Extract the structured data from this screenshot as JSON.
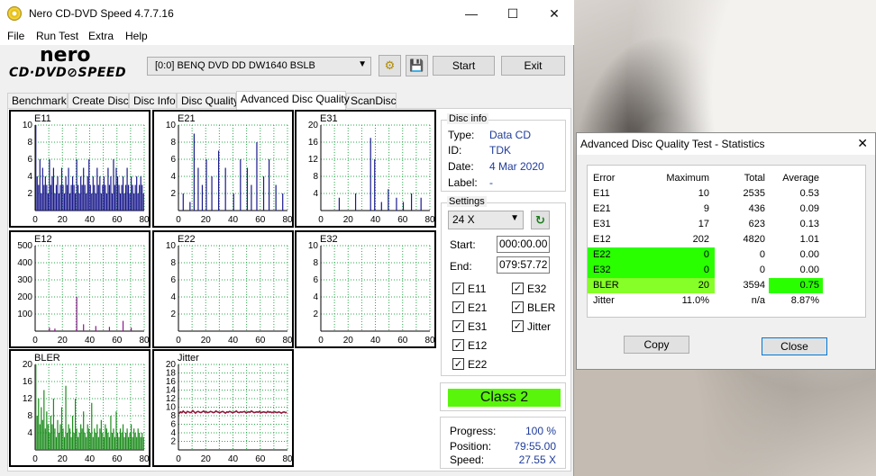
{
  "window": {
    "title": "Nero CD-DVD Speed 4.7.7.16",
    "minimize": "—",
    "maximize": "☐",
    "close": "✕"
  },
  "menu": [
    "File",
    "Run Test",
    "Extra",
    "Help"
  ],
  "logo": {
    "line1": "nero",
    "line2": "CD·DVD⊘SPEED"
  },
  "drive": {
    "selected": "[0:0]   BENQ DVD DD DW1640 BSLB"
  },
  "toolbar": {
    "start": "Start",
    "exit": "Exit"
  },
  "tabs": [
    "Benchmark",
    "Create Disc",
    "Disc Info",
    "Disc Quality",
    "Advanced Disc Quality",
    "ScanDisc"
  ],
  "active_tab": 4,
  "disc_info": {
    "legend": "Disc info",
    "type_label": "Type:",
    "type": "Data CD",
    "id_label": "ID:",
    "id": "TDK",
    "date_label": "Date:",
    "date": "4 Mar 2020",
    "label_label": "Label:",
    "label": "-"
  },
  "settings": {
    "legend": "Settings",
    "speed": "24 X",
    "start_label": "Start:",
    "start": "000:00.00",
    "end_label": "End:",
    "end": "079:57.72",
    "checks": [
      {
        "label": "E11",
        "checked": true
      },
      {
        "label": "E32",
        "checked": true
      },
      {
        "label": "E21",
        "checked": true
      },
      {
        "label": "BLER",
        "checked": true
      },
      {
        "label": "E31",
        "checked": true
      },
      {
        "label": "Jitter",
        "checked": true
      },
      {
        "label": "E12",
        "checked": true
      },
      {
        "label": "E22",
        "checked": true
      }
    ]
  },
  "class": "Class 2",
  "progress": {
    "progress_label": "Progress:",
    "progress": "100 %",
    "position_label": "Position:",
    "position": "79:55.00",
    "speed_label": "Speed:",
    "speed": "27.55 X"
  },
  "colors": {
    "e_bar": "#1a1a8c",
    "e12_bar": "#8c1a8c",
    "bler_bar": "#1c8c1c",
    "jitter": "#8c1a3c",
    "grid": "#2aa84a",
    "class_bg": "#59f50b",
    "hl_green": "#2aff00",
    "hl_lime": "#86ff28"
  },
  "chart_data": [
    {
      "type": "bar",
      "title": "E11",
      "x_ticks": [
        0,
        20,
        40,
        60,
        80
      ],
      "y_ticks": [
        2,
        4,
        6,
        8,
        10
      ],
      "ylim": [
        0,
        10
      ],
      "xlim": [
        0,
        80
      ],
      "values": [
        10,
        4,
        3,
        6,
        2,
        5,
        3,
        4,
        3,
        2,
        6,
        3,
        4,
        5,
        2,
        3,
        4,
        2,
        3,
        5,
        3,
        2,
        4,
        3,
        5,
        2,
        3,
        4,
        3,
        2,
        6,
        3,
        2,
        4,
        3,
        5,
        3,
        2,
        4,
        6,
        3,
        2,
        4,
        3,
        2,
        5,
        3,
        4,
        2,
        3,
        4,
        3,
        2,
        5,
        3,
        4,
        2,
        6,
        3,
        5,
        4,
        3,
        2,
        3,
        4,
        2,
        3,
        5,
        3,
        2,
        4,
        3,
        2,
        3,
        4,
        2,
        3,
        4,
        3,
        2
      ]
    },
    {
      "type": "bar",
      "title": "E21",
      "x_ticks": [
        0,
        20,
        40,
        60,
        80
      ],
      "y_ticks": [
        2,
        4,
        6,
        8,
        10
      ],
      "ylim": [
        0,
        10
      ],
      "xlim": [
        0,
        80
      ],
      "values": [
        0,
        0,
        0,
        2,
        0,
        0,
        0,
        0,
        1,
        0,
        0,
        9,
        0,
        0,
        5,
        0,
        0,
        3,
        0,
        0,
        6,
        0,
        0,
        0,
        4,
        0,
        0,
        0,
        0,
        7,
        0,
        0,
        0,
        0,
        5,
        0,
        0,
        0,
        0,
        0,
        2,
        0,
        0,
        0,
        0,
        6,
        0,
        0,
        0,
        0,
        5,
        0,
        0,
        3,
        0,
        0,
        0,
        8,
        0,
        0,
        0,
        0,
        4,
        0,
        0,
        0,
        6,
        0,
        0,
        0,
        0,
        3,
        0,
        0,
        0,
        0,
        2,
        0,
        0,
        0
      ]
    },
    {
      "type": "bar",
      "title": "E31",
      "x_ticks": [
        0,
        20,
        40,
        60,
        80
      ],
      "y_ticks": [
        4,
        8,
        12,
        16,
        20
      ],
      "ylim": [
        0,
        20
      ],
      "xlim": [
        0,
        80
      ],
      "values": [
        0,
        0,
        0,
        0,
        0,
        0,
        0,
        0,
        0,
        0,
        0,
        0,
        0,
        3,
        0,
        0,
        0,
        0,
        0,
        0,
        0,
        0,
        0,
        0,
        0,
        4,
        0,
        0,
        0,
        0,
        0,
        0,
        0,
        0,
        0,
        0,
        17,
        0,
        0,
        12,
        0,
        0,
        0,
        0,
        2,
        0,
        0,
        0,
        0,
        5,
        0,
        0,
        0,
        0,
        0,
        3,
        0,
        0,
        0,
        0,
        2,
        0,
        0,
        0,
        0,
        0,
        4,
        0,
        0,
        0,
        0,
        0,
        0,
        3,
        0,
        0,
        0,
        0,
        0,
        0
      ]
    },
    {
      "type": "bar",
      "title": "E12",
      "x_ticks": [
        0,
        20,
        40,
        60,
        80
      ],
      "y_ticks": [
        100,
        200,
        300,
        400,
        500
      ],
      "ylim": [
        0,
        500
      ],
      "xlim": [
        0,
        80
      ],
      "values": [
        0,
        0,
        0,
        0,
        0,
        0,
        0,
        0,
        0,
        0,
        20,
        0,
        0,
        0,
        15,
        0,
        0,
        0,
        0,
        0,
        0,
        0,
        0,
        0,
        0,
        0,
        0,
        0,
        0,
        0,
        202,
        0,
        0,
        0,
        0,
        40,
        0,
        0,
        0,
        0,
        0,
        0,
        0,
        0,
        30,
        0,
        0,
        0,
        0,
        0,
        0,
        0,
        0,
        0,
        25,
        0,
        0,
        0,
        0,
        0,
        0,
        0,
        0,
        0,
        60,
        0,
        0,
        0,
        0,
        0,
        20,
        0,
        0,
        0,
        0,
        0,
        0,
        0,
        0,
        0
      ]
    },
    {
      "type": "bar",
      "title": "E22",
      "x_ticks": [
        0,
        20,
        40,
        60,
        80
      ],
      "y_ticks": [
        2,
        4,
        6,
        8,
        10
      ],
      "ylim": [
        0,
        10
      ],
      "xlim": [
        0,
        80
      ],
      "values": []
    },
    {
      "type": "bar",
      "title": "E32",
      "x_ticks": [
        0,
        20,
        40,
        60,
        80
      ],
      "y_ticks": [
        2,
        4,
        6,
        8,
        10
      ],
      "ylim": [
        0,
        10
      ],
      "xlim": [
        0,
        80
      ],
      "values": []
    },
    {
      "type": "bar",
      "title": "BLER",
      "x_ticks": [
        0,
        20,
        40,
        60,
        80
      ],
      "y_ticks": [
        4,
        8,
        12,
        16,
        20
      ],
      "ylim": [
        0,
        20
      ],
      "xlim": [
        0,
        80
      ],
      "values": [
        20,
        8,
        12,
        6,
        10,
        7,
        14,
        5,
        9,
        6,
        4,
        8,
        6,
        12,
        5,
        3,
        7,
        4,
        6,
        10,
        5,
        3,
        15,
        4,
        6,
        5,
        3,
        8,
        4,
        12,
        5,
        3,
        4,
        6,
        5,
        9,
        4,
        3,
        6,
        5,
        4,
        11,
        3,
        5,
        4,
        6,
        3,
        5,
        7,
        4,
        3,
        6,
        5,
        4,
        3,
        8,
        4,
        5,
        3,
        9,
        4,
        3,
        5,
        4,
        6,
        3,
        4,
        5,
        3,
        4,
        6,
        3,
        5,
        4,
        3,
        5,
        4,
        3,
        4,
        3
      ]
    },
    {
      "type": "line",
      "title": "Jitter",
      "x_ticks": [
        0,
        20,
        40,
        60,
        80
      ],
      "y_ticks": [
        2,
        4,
        6,
        8,
        10,
        12,
        14,
        16,
        18,
        20
      ],
      "ylim": [
        0,
        20
      ],
      "xlim": [
        0,
        80
      ],
      "values": [
        8.5,
        8.9,
        8.7,
        9.1,
        8.8,
        8.6,
        9.0,
        8.9,
        8.7,
        8.8,
        9.2,
        8.9,
        8.6,
        8.9,
        9.0,
        8.8,
        8.7,
        8.9,
        9.1,
        8.8,
        8.9,
        8.7,
        8.8,
        9.0,
        8.9,
        8.7,
        8.8,
        9.1,
        8.9,
        8.8,
        8.7,
        8.9,
        9.0,
        8.8,
        8.6,
        8.9,
        8.8,
        9.0,
        8.9,
        8.7,
        8.8,
        8.9,
        9.1,
        8.8,
        8.7,
        8.9,
        8.8,
        8.9,
        9.0,
        8.7,
        8.8,
        8.9,
        8.8,
        9.1,
        8.9,
        8.7,
        8.8,
        8.9,
        8.8,
        9.0,
        8.7,
        8.8,
        8.9,
        8.8,
        8.7,
        9.0,
        8.8,
        8.9,
        8.7,
        8.8,
        8.9,
        8.8,
        8.7,
        8.9,
        8.8,
        8.6,
        8.8,
        8.9,
        8.7,
        8.8
      ]
    }
  ],
  "stats_dialog": {
    "title": "Advanced Disc Quality Test - Statistics",
    "close": "✕",
    "headers": [
      "Error",
      "Maximum",
      "Total",
      "Average"
    ],
    "rows": [
      {
        "name": "E11",
        "max": "10",
        "total": "2535",
        "avg": "0.53",
        "hl": ""
      },
      {
        "name": "E21",
        "max": "9",
        "total": "436",
        "avg": "0.09",
        "hl": ""
      },
      {
        "name": "E31",
        "max": "17",
        "total": "623",
        "avg": "0.13",
        "hl": ""
      },
      {
        "name": "E12",
        "max": "202",
        "total": "4820",
        "avg": "1.01",
        "hl": ""
      },
      {
        "name": "E22",
        "max": "0",
        "total": "0",
        "avg": "0.00",
        "hl": "green"
      },
      {
        "name": "E32",
        "max": "0",
        "total": "0",
        "avg": "0.00",
        "hl": "green"
      },
      {
        "name": "BLER",
        "max": "20",
        "total": "3594",
        "avg": "0.75",
        "hl": "lime"
      },
      {
        "name": "Jitter",
        "max": "11.0%",
        "total": "n/a",
        "avg": "8.87%",
        "hl": ""
      }
    ],
    "copy": "Copy",
    "close_btn": "Close"
  }
}
